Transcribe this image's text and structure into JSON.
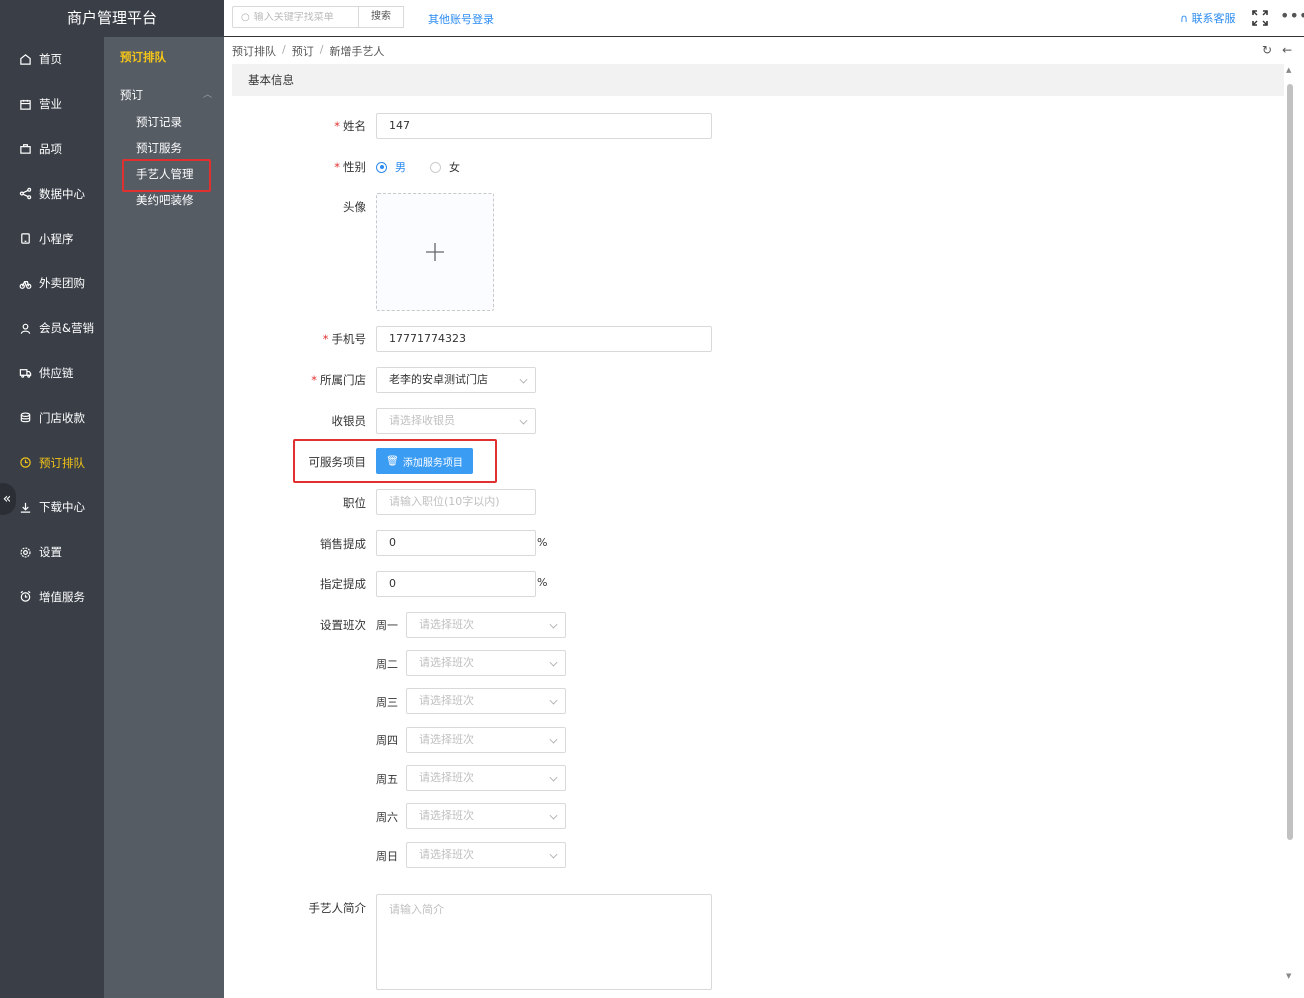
{
  "brand": "商户管理平台",
  "nav": [
    {
      "label": "首页",
      "icon": "home-icon"
    },
    {
      "label": "营业",
      "icon": "calendar-icon"
    },
    {
      "label": "品项",
      "icon": "bag-icon"
    },
    {
      "label": "数据中心",
      "icon": "share-icon"
    },
    {
      "label": "小程序",
      "icon": "phone-icon"
    },
    {
      "label": "外卖团购",
      "icon": "bike-icon"
    },
    {
      "label": "会员&营销",
      "icon": "user-icon"
    },
    {
      "label": "供应链",
      "icon": "truck-icon"
    },
    {
      "label": "门店收款",
      "icon": "coins-icon"
    },
    {
      "label": "预订排队",
      "icon": "clock-icon",
      "active": true
    },
    {
      "label": "下载中心",
      "icon": "download-icon"
    },
    {
      "label": "设置",
      "icon": "gear-icon"
    },
    {
      "label": "增值服务",
      "icon": "alarm-icon"
    }
  ],
  "subnav": {
    "title": "预订排队",
    "group": "预订",
    "items": [
      "预订记录",
      "预订服务",
      "手艺人管理",
      "美约吧装修"
    ]
  },
  "topbar": {
    "search_placeholder": "输入关键字找菜单",
    "search_button": "搜索",
    "other_login": "其他账号登录",
    "contact": "联系客服"
  },
  "breadcrumb": [
    "预订排队",
    "预订",
    "新增手艺人"
  ],
  "section_title": "基本信息",
  "form": {
    "name_label": "姓名",
    "name_value": "147",
    "gender_label": "性别",
    "gender_male": "男",
    "gender_female": "女",
    "avatar_label": "头像",
    "phone_label": "手机号",
    "phone_value": "17771774323",
    "store_label": "所属门店",
    "store_value": "老李的安卓测试门店",
    "cashier_label": "收银员",
    "cashier_placeholder": "请选择收银员",
    "service_label": "可服务项目",
    "service_button": "添加服务项目",
    "position_label": "职位",
    "position_placeholder": "请输入职位(10字以内)",
    "sales_label": "销售提成",
    "sales_value": "0",
    "assign_label": "指定提成",
    "assign_value": "0",
    "percent": "%",
    "shift_label": "设置班次",
    "shift_placeholder": "请选择班次",
    "days": [
      "周一",
      "周二",
      "周三",
      "周四",
      "周五",
      "周六",
      "周日"
    ],
    "intro_label": "手艺人简介",
    "intro_placeholder": "请输入简介"
  },
  "colors": {
    "accent": "#2d8cf0",
    "active_nav": "#f5c518",
    "highlight": "#e03030",
    "sidebar": "#3a3f47",
    "subnav": "#565c64"
  }
}
